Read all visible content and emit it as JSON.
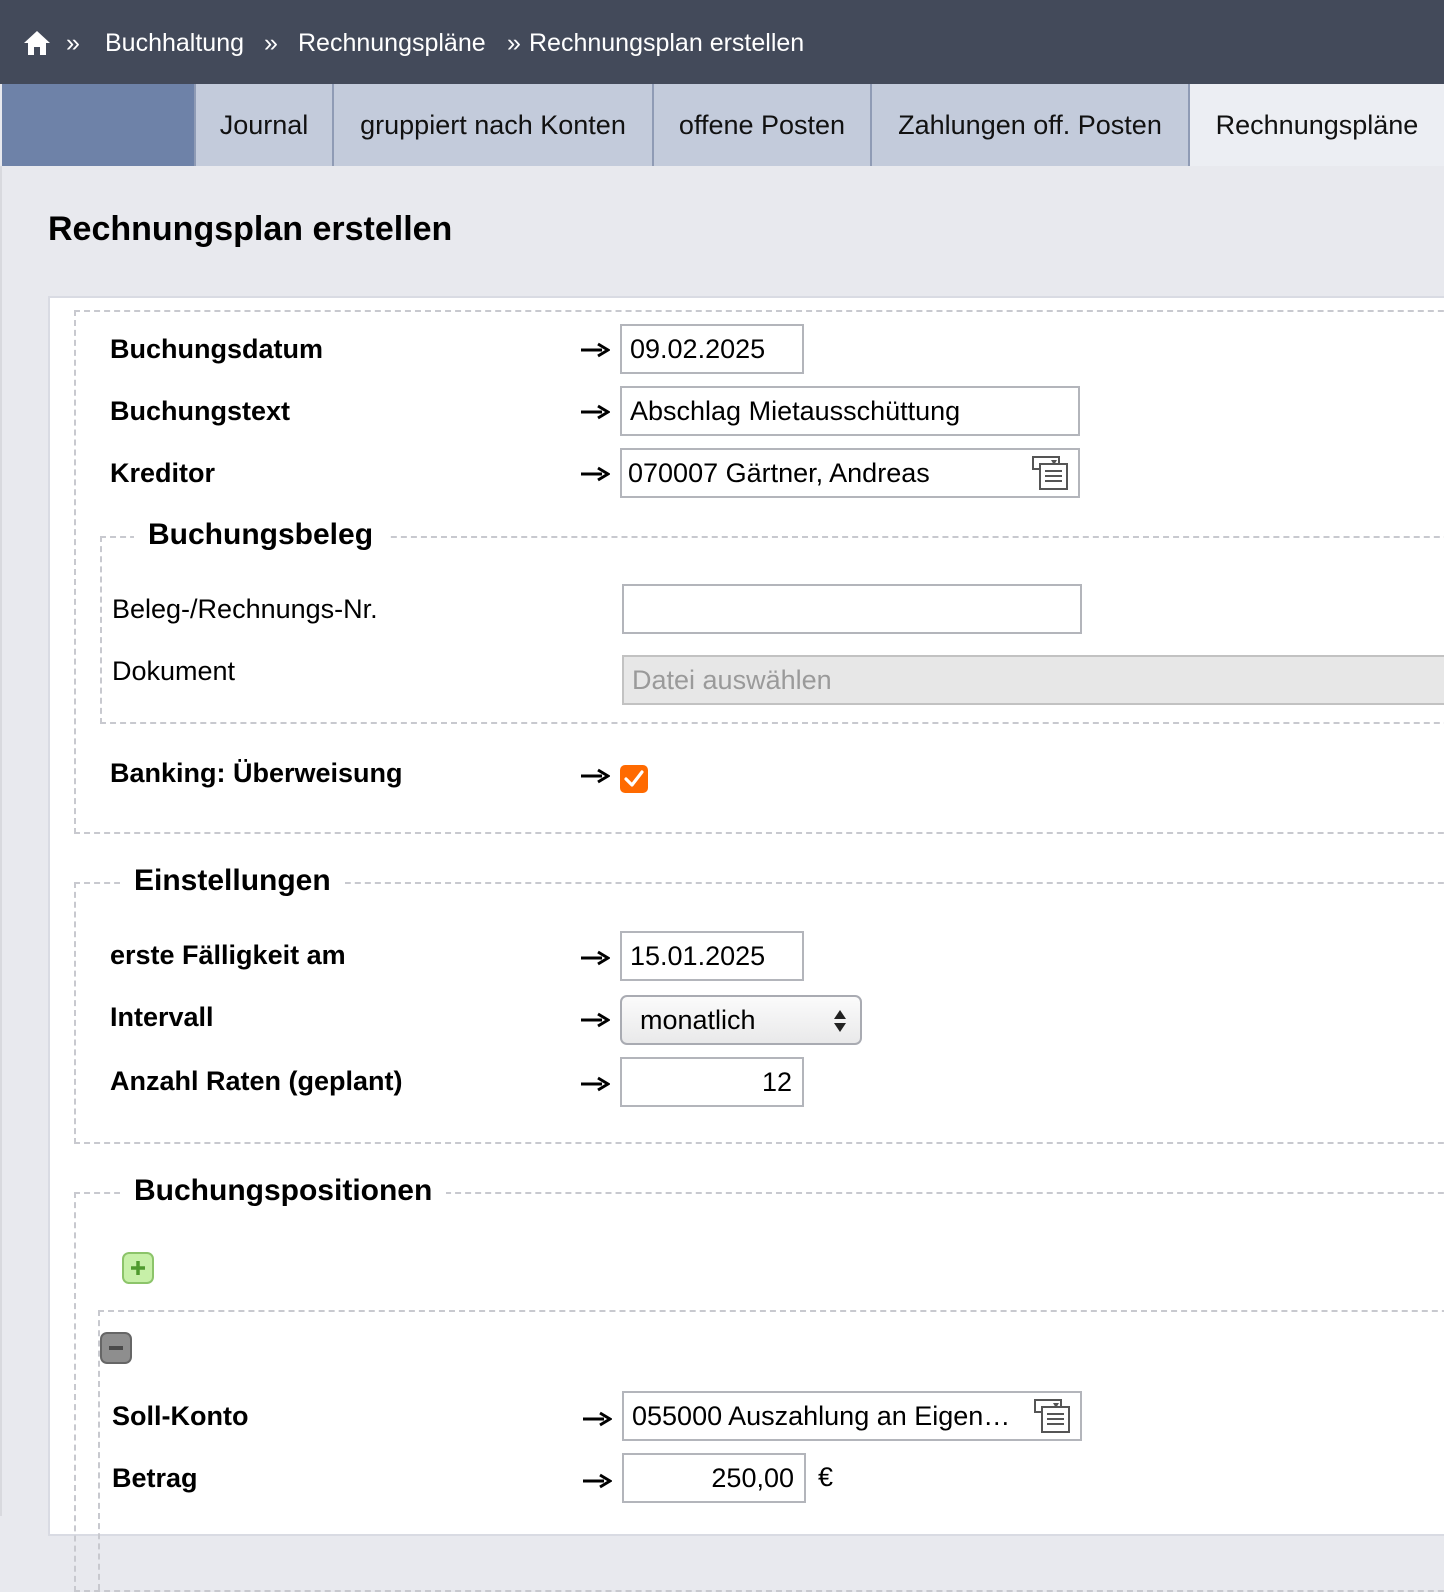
{
  "breadcrumb": {
    "separator": "»",
    "items": [
      "Buchhaltung",
      "Rechnungspläne",
      "Rechnungsplan erstellen"
    ]
  },
  "tabs": [
    "Journal",
    "gruppiert nach Konten",
    "offene Posten",
    "Zahlungen off. Posten",
    "Rechnungspläne"
  ],
  "page_title": "Rechnungsplan erstellen",
  "form": {
    "buchungsdatum": {
      "label": "Buchungsdatum",
      "value": "09.02.2025"
    },
    "buchungstext": {
      "label": "Buchungstext",
      "value": "Abschlag Mietausschüttung"
    },
    "kreditor": {
      "label": "Kreditor",
      "value": "070007 Gärtner, Andreas"
    },
    "buchungsbeleg": {
      "legend": "Buchungsbeleg",
      "beleg_label": "Beleg-/Rechnungs-Nr.",
      "beleg_value": "",
      "dokument_label": "Dokument",
      "dokument_button": "Datei auswählen"
    },
    "banking": {
      "label": "Banking: Überweisung",
      "checked": true
    }
  },
  "einstellungen": {
    "legend": "Einstellungen",
    "faelligkeit": {
      "label": "erste Fälligkeit am",
      "value": "15.01.2025"
    },
    "intervall": {
      "label": "Intervall",
      "value": "monatlich"
    },
    "raten": {
      "label": "Anzahl Raten (geplant)",
      "value": "12"
    }
  },
  "positionen": {
    "legend": "Buchungspositionen",
    "soll_konto": {
      "label": "Soll-Konto",
      "value": "055000 Auszahlung an Eigen…"
    },
    "betrag": {
      "label": "Betrag",
      "value": "250,00",
      "currency": "€"
    }
  },
  "colors": {
    "header": "#434a5a",
    "tab": "#c3cbdb",
    "checkbox": "#ff6a00"
  }
}
